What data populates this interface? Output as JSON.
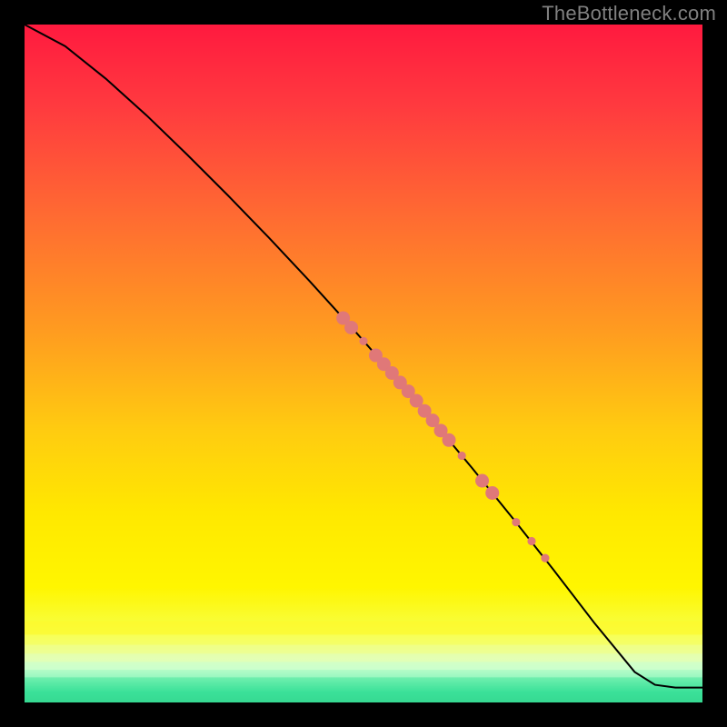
{
  "watermark": "TheBottleneck.com",
  "chart_data": {
    "type": "line",
    "title": "",
    "xlabel": "",
    "ylabel": "",
    "xlim": [
      0,
      100
    ],
    "ylim": [
      0,
      100
    ],
    "grid": false,
    "legend": false,
    "gradient_stops": [
      {
        "pos": 0.0,
        "color": "#ff1a3f"
      },
      {
        "pos": 0.12,
        "color": "#ff3a3f"
      },
      {
        "pos": 0.28,
        "color": "#ff6a32"
      },
      {
        "pos": 0.45,
        "color": "#ff9b20"
      },
      {
        "pos": 0.6,
        "color": "#ffcc10"
      },
      {
        "pos": 0.72,
        "color": "#ffe800"
      },
      {
        "pos": 0.83,
        "color": "#fff600"
      },
      {
        "pos": 0.9,
        "color": "#f6ff4a"
      },
      {
        "pos": 0.935,
        "color": "#e8ffb0"
      },
      {
        "pos": 0.955,
        "color": "#c8ffd0"
      },
      {
        "pos": 0.97,
        "color": "#70f0b0"
      },
      {
        "pos": 0.985,
        "color": "#20d890"
      },
      {
        "pos": 1.0,
        "color": "#18c880"
      }
    ],
    "band_fractions": [
      0.88,
      0.9,
      0.915,
      0.928,
      0.94,
      0.952,
      0.963
    ],
    "band_colors": [
      "#fff82a",
      "#f8ff60",
      "#eeff90",
      "#e0ffb8",
      "#c8ffd0",
      "#98f8c0",
      "#50e8a0"
    ],
    "series": [
      {
        "name": "curve",
        "color": "#000000",
        "x": [
          0,
          6,
          12,
          18,
          24,
          30,
          36,
          42,
          48,
          54,
          60,
          66,
          72,
          78,
          84,
          90,
          93,
          96,
          100
        ],
        "y": [
          100,
          96.8,
          92.0,
          86.6,
          80.8,
          74.8,
          68.6,
          62.2,
          55.6,
          48.8,
          41.8,
          34.6,
          27.2,
          19.6,
          11.8,
          4.5,
          2.6,
          2.2,
          2.2
        ]
      }
    ],
    "points": {
      "color": "#e07878",
      "radius_small": 4.6,
      "radius_large": 7.5,
      "xy": [
        [
          47.0,
          56.7,
          "l"
        ],
        [
          48.2,
          55.3,
          "l"
        ],
        [
          50.0,
          53.3,
          "s"
        ],
        [
          51.8,
          51.2,
          "l"
        ],
        [
          53.0,
          49.9,
          "l"
        ],
        [
          54.2,
          48.6,
          "l"
        ],
        [
          55.4,
          47.2,
          "l"
        ],
        [
          56.6,
          45.9,
          "l"
        ],
        [
          57.8,
          44.5,
          "l"
        ],
        [
          59.0,
          43.0,
          "l"
        ],
        [
          60.2,
          41.6,
          "l"
        ],
        [
          61.4,
          40.1,
          "l"
        ],
        [
          62.6,
          38.7,
          "l"
        ],
        [
          64.5,
          36.4,
          "s"
        ],
        [
          67.5,
          32.7,
          "l"
        ],
        [
          69.0,
          30.9,
          "l"
        ],
        [
          72.5,
          26.6,
          "s"
        ],
        [
          74.8,
          23.8,
          "s"
        ],
        [
          76.8,
          21.3,
          "s"
        ]
      ]
    }
  }
}
